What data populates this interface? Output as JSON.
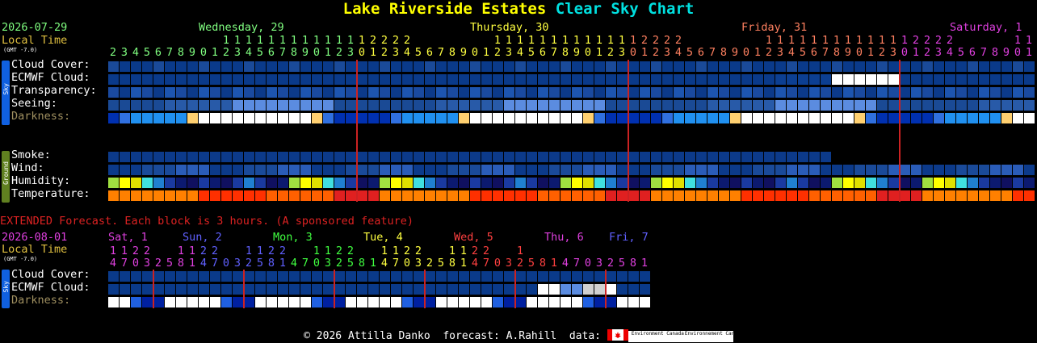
{
  "title": {
    "place": "Lake Riverside Estates",
    "suffix": "Clear Sky Chart"
  },
  "main": {
    "date": "2026-07-29",
    "local_time": "Local Time",
    "gmt": "(GMT -7.0)",
    "days": [
      {
        "label": "Wednesday, 29",
        "color": "#80ff80"
      },
      {
        "label": "Thursday, 30",
        "color": "#ffff40"
      },
      {
        "label": "Friday, 31",
        "color": "#ff8060"
      },
      {
        "label": "Saturday, 1",
        "color": "#e040e0"
      }
    ],
    "tens_rows": [
      {
        "start": 10,
        "digits": "11111111111112222"
      },
      {
        "start": 34,
        "digits": "11111111111112222"
      },
      {
        "start": 58,
        "digits": "11111111111112222"
      },
      {
        "start": 80,
        "digits": "11"
      }
    ],
    "hour_digits": "234567890123456789012301234567890123456789012301234567890123456789012301234567890123456789012301",
    "labels": [
      "Cloud Cover:",
      "ECMWF Cloud:",
      "Transparency:",
      "Seeing:",
      "Darkness:"
    ],
    "ground_labels": [
      "Smoke:",
      "Wind:",
      "Humidity:",
      "Temperature:"
    ],
    "sky_side": "Sky",
    "ground_side": "Ground"
  },
  "extended": {
    "banner": "EXTENDED Forecast. Each block is 3 hours. (A sponsored feature)",
    "date": "2026-08-01",
    "local_time": "Local Time",
    "gmt": "(GMT -7.0)",
    "days": [
      {
        "label": "Sat, 1",
        "color": "#e040e0"
      },
      {
        "label": "Sun, 2",
        "color": "#6060ff"
      },
      {
        "label": "Mon, 3",
        "color": "#40ff40"
      },
      {
        "label": "Tue, 4",
        "color": "#ffff40"
      },
      {
        "label": "Wed, 5",
        "color": "#ff4040"
      },
      {
        "label": "Thu, 6",
        "color": "#e040e0"
      },
      {
        "label": "Fri, 7",
        "color": "#6060ff"
      }
    ],
    "tens_digits": "1122  1122  1122  1122  1122  1122  1",
    "hour_digits": "470325814703258147032581470325814703258147032581",
    "labels": [
      "Cloud Cover:",
      "ECMWF Cloud:",
      "Darkness:"
    ],
    "sky_side": "Sky"
  },
  "footer": {
    "text": "© 2026 Attilla Danko  forecast: A.Rahill  data:",
    "logo1": "Environment Canada",
    "logo2": "Environnement Canada"
  },
  "colors": {
    "cloud": "#0a3a8a",
    "cloud2": "#1a4a99",
    "seeing_good": "#5b8ce0",
    "seeing_mid": "#2a5cb8",
    "night": "#0030b0",
    "day": "#ffffff",
    "twilight": "#2090f0",
    "marker": "#cc2222"
  }
}
